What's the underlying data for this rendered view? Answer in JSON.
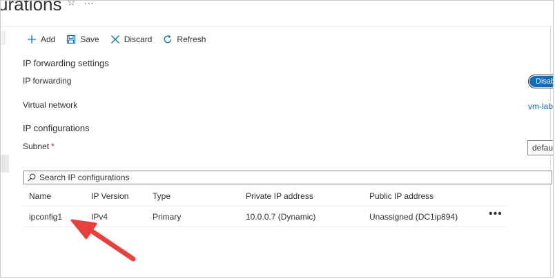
{
  "page": {
    "title": "urations",
    "star": "☆",
    "more": "..."
  },
  "toolbar": {
    "add_label": "Add",
    "save_label": "Save",
    "discard_label": "Discard",
    "refresh_label": "Refresh"
  },
  "ip_forwarding": {
    "section_title": "IP forwarding settings",
    "label": "IP forwarding",
    "toggle_value": "Disabled"
  },
  "virtual_network": {
    "label": "Virtual network",
    "value": "vm-lab"
  },
  "ip_configurations": {
    "section_title": "IP configurations",
    "subnet_label": "Subnet",
    "required_marker": "*",
    "subnet_value": "default"
  },
  "search": {
    "placeholder": "Search IP configurations"
  },
  "table": {
    "columns": {
      "name": "Name",
      "ip_version": "IP Version",
      "type": "Type",
      "private_ip": "Private IP address",
      "public_ip": "Public IP address"
    },
    "rows": [
      {
        "name": "ipconfig1",
        "ip_version": "IPv4",
        "type": "Primary",
        "private_ip": "10.0.0.7 (Dynamic)",
        "public_ip": "Unassigned (DC1ip894)",
        "more": "•••"
      }
    ]
  },
  "colors": {
    "accent": "#0f6cbd",
    "annotation_arrow": "#e8403a"
  }
}
